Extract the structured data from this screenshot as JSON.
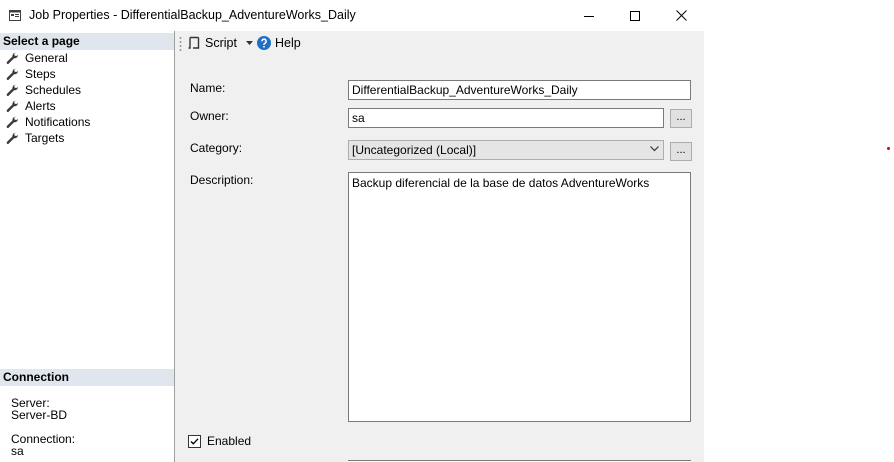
{
  "window": {
    "title": "Job Properties - DifferentialBackup_AdventureWorks_Daily"
  },
  "sidebar": {
    "select_header": "Select a page",
    "pages": [
      {
        "label": "General",
        "icon": "wrench-icon"
      },
      {
        "label": "Steps",
        "icon": "wrench-icon"
      },
      {
        "label": "Schedules",
        "icon": "wrench-icon"
      },
      {
        "label": "Alerts",
        "icon": "wrench-icon"
      },
      {
        "label": "Notifications",
        "icon": "wrench-icon"
      },
      {
        "label": "Targets",
        "icon": "wrench-icon"
      }
    ],
    "connection_header": "Connection",
    "server_label": "Server:",
    "server_value": "Server-BD",
    "connection_label": "Connection:",
    "connection_value": "sa"
  },
  "toolbar": {
    "script_label": "Script",
    "help_label": "Help"
  },
  "form": {
    "name_label": "Name:",
    "name_value": "DifferentialBackup_AdventureWorks_Daily",
    "owner_label": "Owner:",
    "owner_value": "sa",
    "browse_label": "...",
    "category_label": "Category:",
    "category_value": "[Uncategorized (Local)]",
    "description_label": "Description:",
    "description_value": "Backup diferencial de la base de datos AdventureWorks",
    "enabled_label": "Enabled",
    "enabled_checked": true
  },
  "colors": {
    "section_header_bg": "#dfe6ee",
    "help_icon": "#1e6fc8",
    "window_bg": "#f0f0f0"
  }
}
